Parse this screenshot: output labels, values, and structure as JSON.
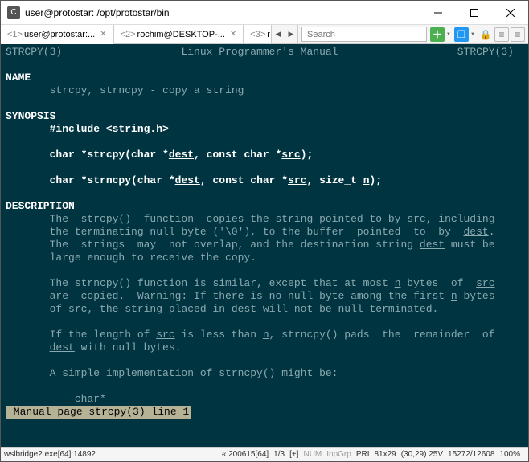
{
  "window": {
    "title": "user@protostar: /opt/protostar/bin"
  },
  "tabs": {
    "items": [
      {
        "idx": "<1>",
        "label": "user@protostar:..."
      },
      {
        "idx": "<2>",
        "label": "rochim@DESKTOP-..."
      },
      {
        "idx": "<3>",
        "label": "r"
      }
    ]
  },
  "search": {
    "placeholder": "Search"
  },
  "man": {
    "hl": "STRCPY(3)",
    "hc": "Linux Programmer's Manual",
    "hr": "STRCPY(3)",
    "name_h": "NAME",
    "name_l": "       strcpy, strncpy - copy a string",
    "syn_h": "SYNOPSIS",
    "inc": "       #include <string.h>",
    "p1a": "       char *strcpy(char *",
    "p1b": ", const char *",
    "p1c": ");",
    "p2a": "       char *strncpy(char *",
    "p2b": ", const char *",
    "p2c": ", size_t ",
    "p2d": ");",
    "dest": "dest",
    "src": "src",
    "n": "n",
    "desc_h": "DESCRIPTION",
    "d1a": "       The  strcpy()  function  copies the string pointed to by ",
    "d1b": ", including",
    "d2a": "       the terminating null byte ('\\0'), to the buffer  pointed  to  by  ",
    "d2b": ".",
    "d3a": "       The  strings  may  not overlap, and the destination string ",
    "d3b": " must be",
    "d4": "       large enough to receive the copy.",
    "d5a": "       The strncpy() function is similar, except that at most ",
    "d5b": " bytes  of  ",
    "d6a": "       are  copied.  Warning: If there is no null byte among the first ",
    "d6b": " bytes",
    "d7a": "       of ",
    "d7b": ", the string placed in ",
    "d7c": " will not be null-terminated.",
    "d8a": "       If the length of ",
    "d8b": " is less than ",
    "d8c": ", strncpy() pads  the  remainder  of",
    "d9a": "       ",
    "d9b": " with null bytes.",
    "d10": "       A simple implementation of strncpy() might be:",
    "d11": "           char*",
    "status": " Manual page strcpy(3) line 1"
  },
  "bottom": {
    "proc": "wslbridge2.exe[64]:14892",
    "buf": "« 200615[64]",
    "pg": "1/3",
    "mod": "[+]",
    "num": "NUM",
    "inp": "InpGrp",
    "pri": "PRI",
    "dim": "81x29",
    "pos": "(30,29) 25V",
    "mem": "15272/12608",
    "pct": "100%"
  }
}
